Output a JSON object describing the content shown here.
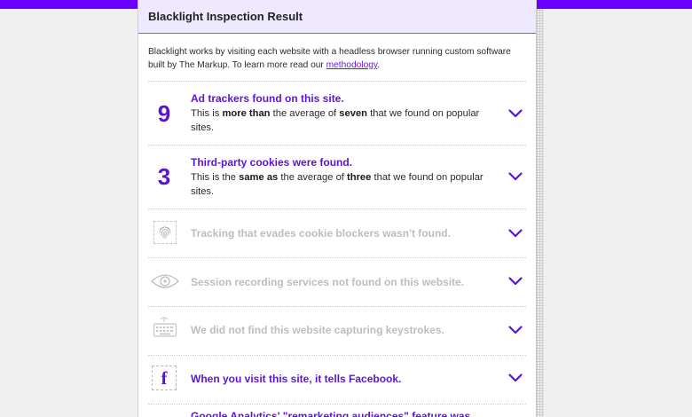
{
  "header": {
    "title": "Blacklight Inspection Result"
  },
  "intro": {
    "text": "Blacklight works by visiting each website with a headless browser running custom software built by The Markup. To learn more read our ",
    "link_label": "methodology",
    "after_link": "."
  },
  "rows": [
    {
      "count": "9",
      "title": "Ad trackers found on this site.",
      "desc_pre": "This is ",
      "desc_b1": "more than",
      "desc_mid": " the average of ",
      "desc_b2": "seven",
      "desc_post": " that we found on popular sites."
    },
    {
      "count": "3",
      "title": "Third-party cookies were found.",
      "desc_pre": "This is the ",
      "desc_b1": "same as",
      "desc_mid": " the average of ",
      "desc_b2": "three",
      "desc_post": " that we found on popular sites."
    }
  ],
  "muted_rows": [
    {
      "icon": "fingerprint-icon",
      "title": "Tracking that evades cookie blockers wasn't found."
    },
    {
      "icon": "eye-icon",
      "title": "Session recording services not found on this website."
    },
    {
      "icon": "keyboard-icon",
      "title": "We did not find this website capturing keystrokes."
    }
  ],
  "facebook_row": {
    "icon": "facebook-icon",
    "letter": "f",
    "title": "When you visit this site, it tells Facebook."
  },
  "footer": {
    "partial_text": "Google Analytics' \"remarketing audiences\" feature was..."
  },
  "colors": {
    "accent": "#5b14d6",
    "topbar": "#6a00ff",
    "header_bg": "#efe9ff"
  }
}
